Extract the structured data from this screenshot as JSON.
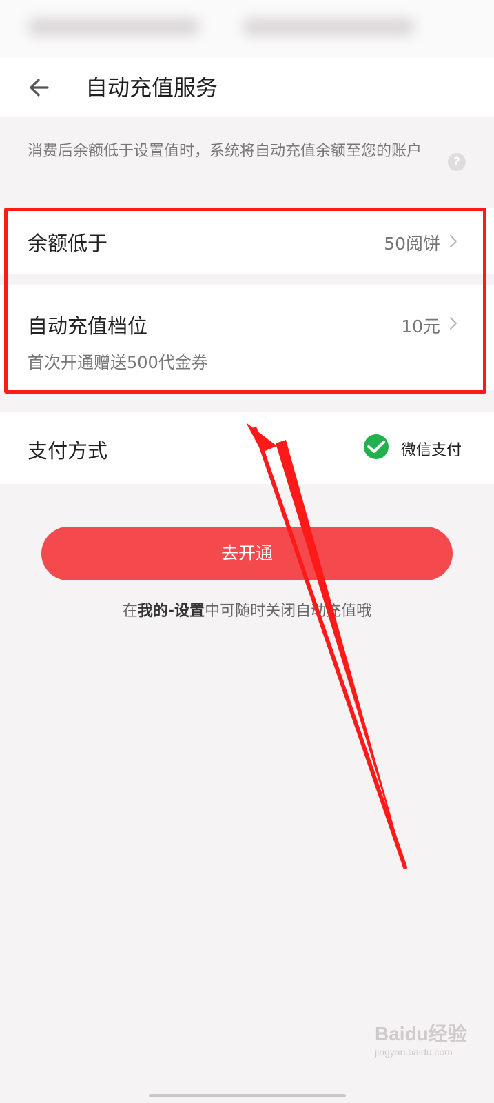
{
  "header": {
    "title": "自动充值服务"
  },
  "description": "消费后余额低于设置值时，系统将自动充值余额至您的账户",
  "rows": {
    "balance": {
      "label": "余额低于",
      "value": "50阅饼"
    },
    "tier": {
      "label": "自动充值档位",
      "value": "10元",
      "sub": "首次开通赠送500代金券"
    },
    "payment": {
      "label": "支付方式",
      "method": "微信支付"
    }
  },
  "action": {
    "label": "去开通"
  },
  "note": {
    "prefix": "在",
    "bold": "我的-设置",
    "suffix": "中可随时关闭自动充值哦"
  },
  "watermark": {
    "logo": "Baidu经验",
    "url": "jingyan.baidu.com"
  },
  "colors": {
    "accent": "#f44a4d",
    "highlight": "#ff1a1a",
    "wechat": "#23b14d"
  },
  "icons": [
    "back-arrow-icon",
    "help-icon",
    "chevron-right-icon",
    "wechat-pay-icon"
  ]
}
